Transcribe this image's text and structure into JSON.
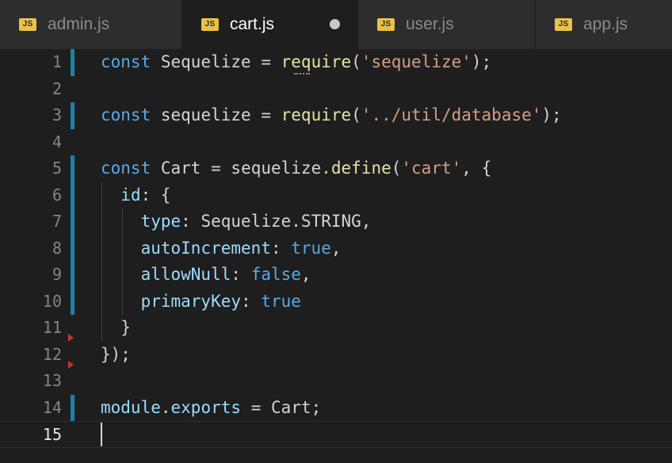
{
  "tabs": [
    {
      "label": "admin.js",
      "badge": "JS",
      "active": false,
      "dirty": false
    },
    {
      "label": "cart.js",
      "badge": "JS",
      "active": true,
      "dirty": true
    },
    {
      "label": "user.js",
      "badge": "JS",
      "active": false,
      "dirty": false
    },
    {
      "label": "app.js",
      "badge": "JS",
      "active": false,
      "dirty": false
    }
  ],
  "editor": {
    "current_line": 15,
    "lines": [
      {
        "num": "1",
        "text": "const Sequelize = require('sequelize');",
        "modified": true
      },
      {
        "num": "2",
        "text": "",
        "modified": false
      },
      {
        "num": "3",
        "text": "const sequelize = require('../util/database');",
        "modified": true
      },
      {
        "num": "4",
        "text": "",
        "modified": false
      },
      {
        "num": "5",
        "text": "const Cart = sequelize.define('cart', {",
        "modified": true
      },
      {
        "num": "6",
        "text": "  id: {",
        "modified": true
      },
      {
        "num": "7",
        "text": "    type: Sequelize.STRING,",
        "modified": true
      },
      {
        "num": "8",
        "text": "    autoIncrement: true,",
        "modified": true
      },
      {
        "num": "9",
        "text": "    allowNull: false,",
        "modified": true
      },
      {
        "num": "10",
        "text": "    primaryKey: true",
        "modified": true
      },
      {
        "num": "11",
        "text": "  }",
        "modified": false
      },
      {
        "num": "12",
        "text": "});",
        "modified": false
      },
      {
        "num": "13",
        "text": "",
        "modified": false
      },
      {
        "num": "14",
        "text": "module.exports = Cart;",
        "modified": true
      },
      {
        "num": "15",
        "text": "",
        "modified": false
      }
    ]
  },
  "colors": {
    "keyword": "#5aa9e6",
    "string": "#d69d85",
    "text": "#d4d4d4",
    "modified_bar": "#1b81a8",
    "js_badge": "#e8c14a"
  }
}
